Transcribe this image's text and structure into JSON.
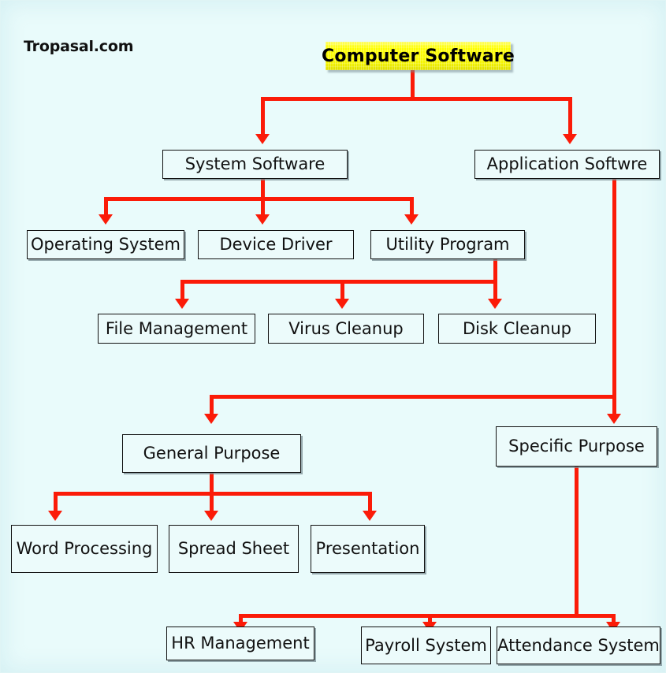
{
  "page": {
    "background_color": "#e9fbfb",
    "connector_color": "#fb1b08",
    "box_border_color": "#111111",
    "title_fill_color": "#ffff00",
    "watermark": "Tropasal.com"
  },
  "diagram": {
    "type": "tree-hierarchy",
    "title": "Computer Software",
    "nodes": {
      "root": "Computer Software",
      "system_software": "System Software",
      "application_software": "Application Softwre",
      "operating_system": "Operating System",
      "device_driver": "Device Driver",
      "utility_program": "Utility Program",
      "file_management": "File Management",
      "virus_cleanup": "Virus Cleanup",
      "disk_cleanup": "Disk Cleanup",
      "general_purpose": "General Purpose",
      "specific_purpose": "Specific Purpose",
      "word_processing": "Word Processing",
      "spread_sheet": "Spread Sheet",
      "presentation": "Presentation",
      "hr_management": "HR Management",
      "payroll_system": "Payroll System",
      "attendance_system": "Attendance System"
    },
    "edges": [
      {
        "from": "Computer Software",
        "to": "System Software"
      },
      {
        "from": "Computer Software",
        "to": "Application Softwre"
      },
      {
        "from": "System Software",
        "to": "Operating System"
      },
      {
        "from": "System Software",
        "to": "Device Driver"
      },
      {
        "from": "System Software",
        "to": "Utility Program"
      },
      {
        "from": "Utility Program",
        "to": "File Management"
      },
      {
        "from": "Utility Program",
        "to": "Virus Cleanup"
      },
      {
        "from": "Utility Program",
        "to": "Disk Cleanup"
      },
      {
        "from": "Application Softwre",
        "to": "General Purpose"
      },
      {
        "from": "Application Softwre",
        "to": "Specific Purpose"
      },
      {
        "from": "General Purpose",
        "to": "Word Processing"
      },
      {
        "from": "General Purpose",
        "to": "Spread Sheet"
      },
      {
        "from": "General Purpose",
        "to": "Presentation"
      },
      {
        "from": "Specific Purpose",
        "to": "HR Management"
      },
      {
        "from": "Specific Purpose",
        "to": "Payroll System"
      },
      {
        "from": "Specific Purpose",
        "to": "Attendance System"
      }
    ]
  }
}
